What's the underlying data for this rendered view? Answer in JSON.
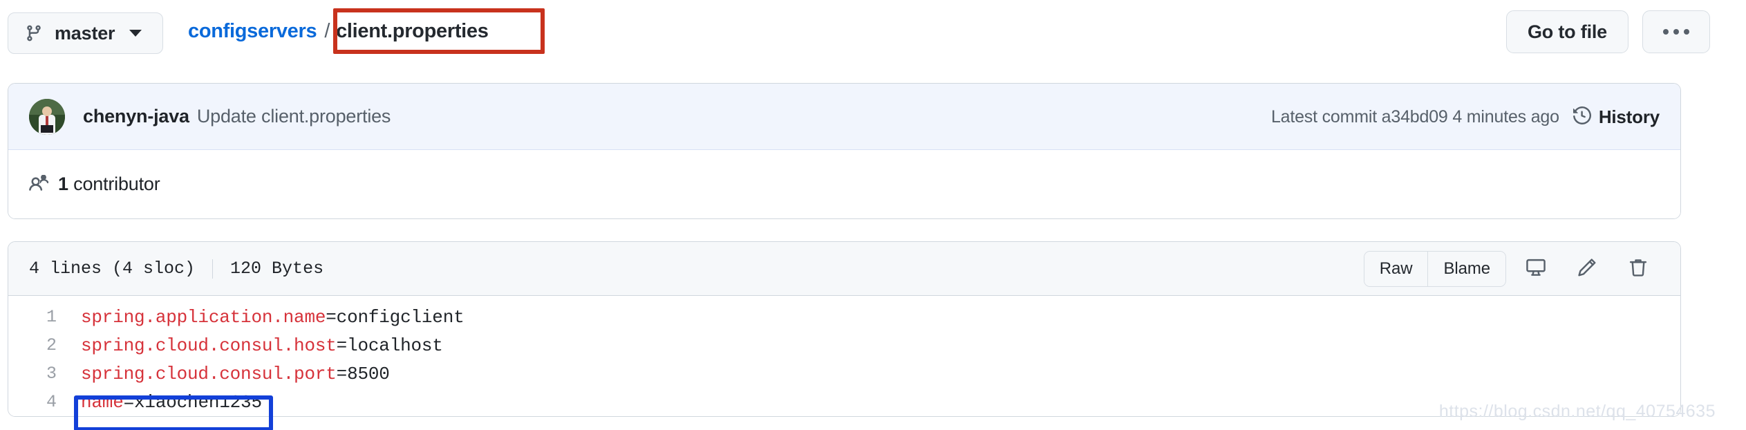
{
  "topbar": {
    "branch": {
      "name": "master",
      "icon": "git-branch-icon",
      "caret": "chevron-down-icon"
    },
    "breadcrumb": {
      "repo": "configservers",
      "separator": "/",
      "file": "client.properties"
    },
    "go_to_file_label": "Go to file",
    "more_options_label": "•••"
  },
  "commit": {
    "author": "chenyn-java",
    "message": "Update client.properties",
    "latest_commit_prefix": "Latest commit",
    "sha": "a34bd09",
    "time_ago": "4 minutes ago",
    "latest_commit_full": "Latest commit a34bd09 4 minutes ago",
    "history_label": "History",
    "history_icon": "history-clock-icon",
    "avatar_icon": "user-avatar"
  },
  "contributors": {
    "icon": "people-icon",
    "count": "1",
    "label": "contributor",
    "full_text": "1 contributor"
  },
  "file": {
    "lines_info": "4 lines (4 sloc)",
    "size": "120 Bytes",
    "actions": {
      "raw": "Raw",
      "blame": "Blame",
      "desktop_icon": "device-desktop-icon",
      "edit_icon": "pencil-icon",
      "delete_icon": "trash-icon"
    },
    "code": [
      {
        "number": "1",
        "key": "spring.application.name",
        "eq": "=",
        "value": "configclient"
      },
      {
        "number": "2",
        "key": "spring.cloud.consul.host",
        "eq": "=",
        "value": "localhost"
      },
      {
        "number": "3",
        "key": "spring.cloud.consul.port",
        "eq": "=",
        "value": "8500"
      },
      {
        "number": "4",
        "key": "name",
        "eq": "=",
        "value": "xiaochen1235"
      }
    ]
  },
  "annotations": {
    "filename_highlight_color": "#c8321d",
    "line4_highlight_color": "#1340d8"
  },
  "watermark": "https://blog.csdn.net/qq_40754635",
  "colors": {
    "link_blue": "#0969da",
    "text_primary": "#1f2328",
    "text_muted": "#57606a",
    "border": "#d0d7de",
    "commit_header_bg": "#f1f5fd",
    "file_header_bg": "#f6f8fa",
    "code_key_red": "#d6323a"
  }
}
